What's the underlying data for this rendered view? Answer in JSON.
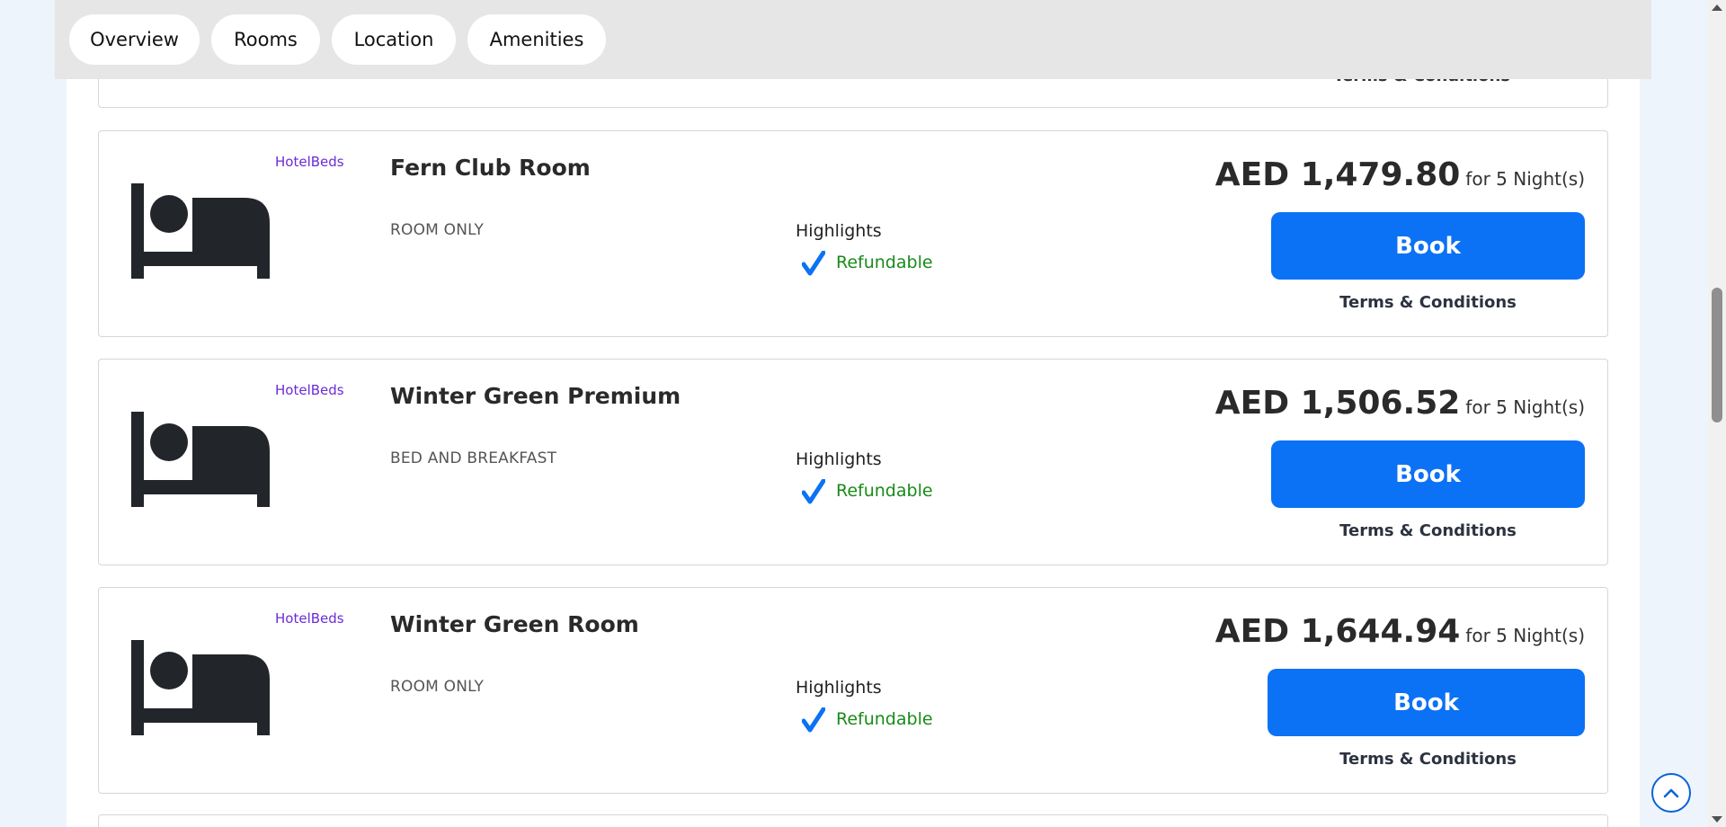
{
  "tabs": [
    {
      "label": "Overview"
    },
    {
      "label": "Rooms"
    },
    {
      "label": "Location"
    },
    {
      "label": "Amenities"
    }
  ],
  "partial_card": {
    "terms_label": "Terms & Conditions"
  },
  "rooms": [
    {
      "provider": "HotelBeds",
      "name": "Fern Club Room",
      "board": "ROOM ONLY",
      "highlights_title": "Highlights",
      "highlight": "Refundable",
      "price": "AED 1,479.80",
      "nights": "for 5 Night(s)",
      "book_label": "Book",
      "terms_label": "Terms & Conditions"
    },
    {
      "provider": "HotelBeds",
      "name": "Winter Green Premium",
      "board": "BED AND BREAKFAST",
      "highlights_title": "Highlights",
      "highlight": "Refundable",
      "price": "AED 1,506.52",
      "nights": "for 5 Night(s)",
      "book_label": "Book",
      "terms_label": "Terms & Conditions"
    },
    {
      "provider": "HotelBeds",
      "name": "Winter Green Room",
      "board": "ROOM ONLY",
      "highlights_title": "Highlights",
      "highlight": "Refundable",
      "price": "AED 1,644.94",
      "nights": "for 5 Night(s)",
      "book_label": "Book",
      "terms_label": "Terms & Conditions"
    }
  ],
  "icons": {
    "room": "bed-icon",
    "highlight": "checkmark-icon",
    "scroll_top": "chevron-up-icon"
  },
  "colors": {
    "accent": "#0b72f5",
    "provider": "#6c2bd9",
    "refundable": "#1a8a1a"
  }
}
